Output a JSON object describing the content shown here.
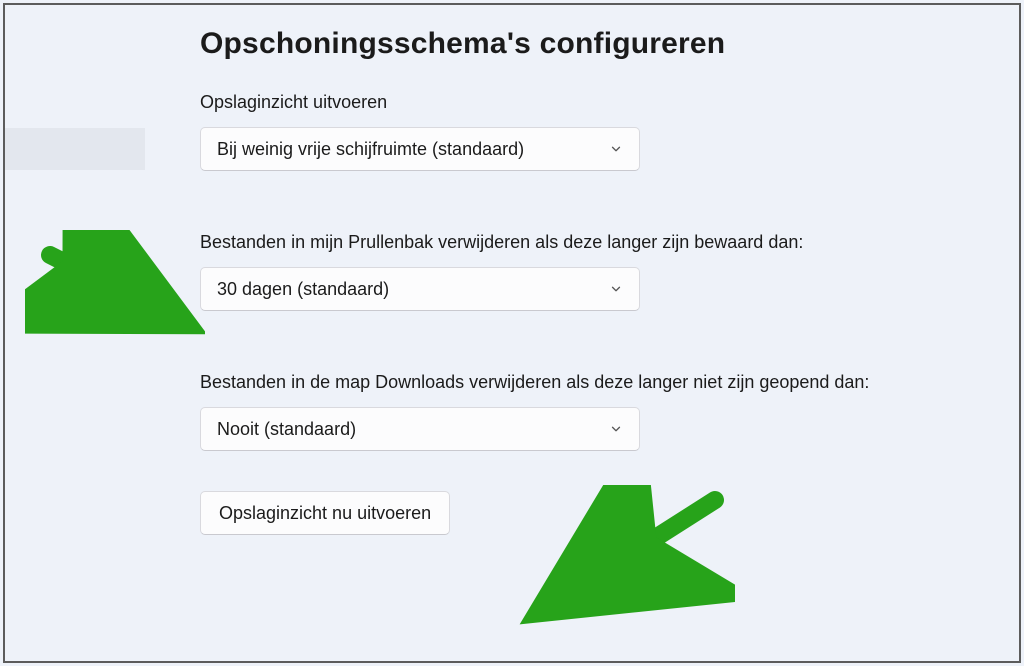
{
  "heading": "Opschoningsschema's configureren",
  "section1": {
    "label": "Opslaginzicht uitvoeren",
    "select_value": "Bij weinig vrije schijfruimte (standaard)"
  },
  "section2": {
    "label": "Bestanden in mijn Prullenbak verwijderen als deze langer zijn bewaard dan:",
    "select_value": "30 dagen (standaard)"
  },
  "section3": {
    "label": "Bestanden in de map Downloads verwijderen als deze langer niet zijn geopend dan:",
    "select_value": "Nooit (standaard)"
  },
  "run_button": "Opslaginzicht nu uitvoeren"
}
